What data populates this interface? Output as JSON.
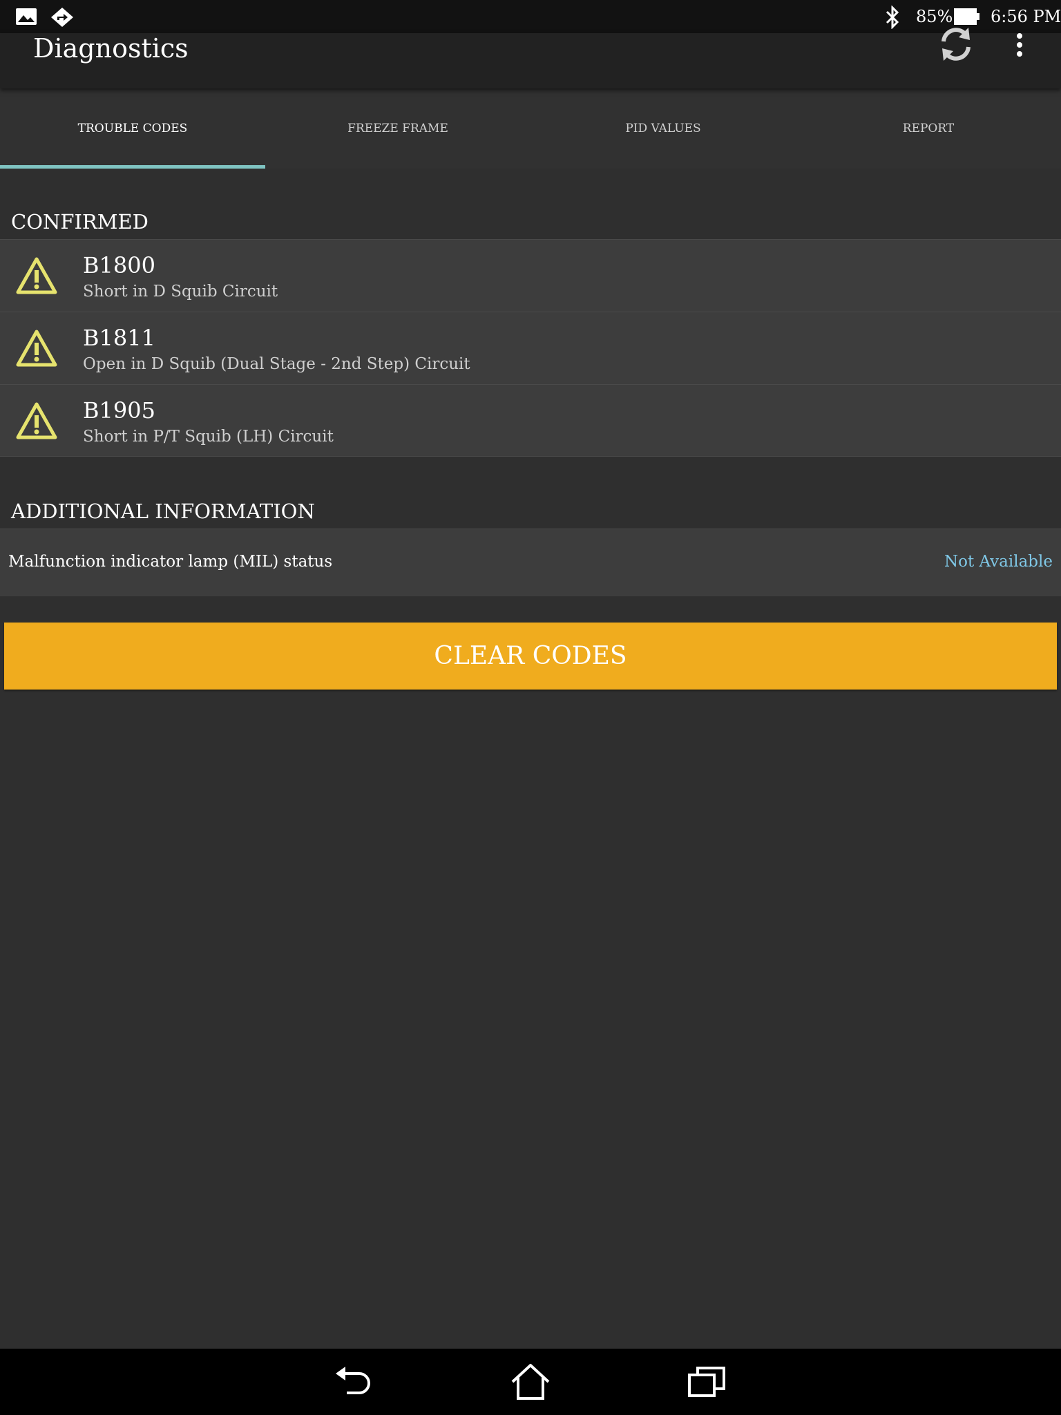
{
  "status_bar": {
    "battery_percent": "85%",
    "time": "6:56 PM",
    "left_icons": [
      "image-icon",
      "navigation-diamond-icon"
    ],
    "right_icons": [
      "bluetooth-icon",
      "battery-icon"
    ]
  },
  "action_bar": {
    "title": "Diagnostics",
    "actions": [
      "refresh-icon",
      "overflow-menu-icon"
    ]
  },
  "tabs": [
    {
      "label": "TROUBLE CODES",
      "active": true
    },
    {
      "label": "FREEZE FRAME",
      "active": false
    },
    {
      "label": "PID VALUES",
      "active": false
    },
    {
      "label": "REPORT",
      "active": false
    }
  ],
  "confirmed": {
    "header": "CONFIRMED",
    "codes": [
      {
        "code": "B1800",
        "description": "Short in D Squib Circuit",
        "icon": "warning-icon"
      },
      {
        "code": "B1811",
        "description": "Open in D Squib (Dual Stage - 2nd Step) Circuit",
        "icon": "warning-icon"
      },
      {
        "code": "B1905",
        "description": "Short in P/T Squib (LH) Circuit",
        "icon": "warning-icon"
      }
    ]
  },
  "additional_info": {
    "header": "ADDITIONAL INFORMATION",
    "mil_label": "Malfunction indicator lamp (MIL) status",
    "mil_value": "Not Available"
  },
  "clear_button": {
    "label": "CLEAR CODES"
  },
  "colors": {
    "accent_tab": "#7fc4c2",
    "button": "#f0ac1e",
    "warning": "#e6e36e",
    "value_link": "#7fc7e6"
  },
  "nav_bar": {
    "buttons": [
      "back-icon",
      "home-icon",
      "recents-icon"
    ]
  }
}
